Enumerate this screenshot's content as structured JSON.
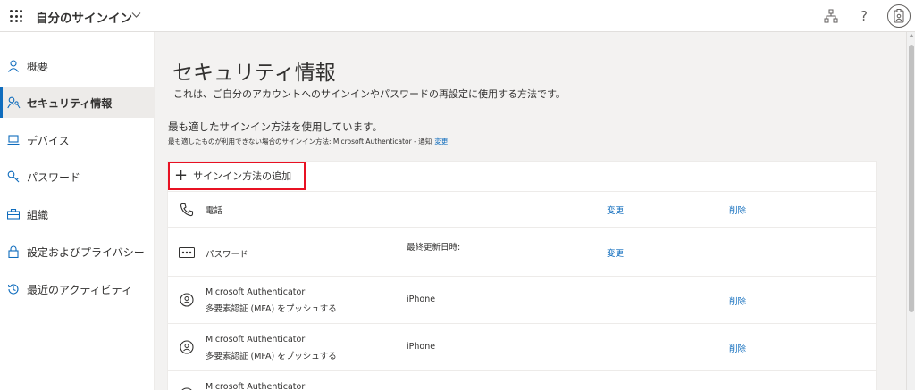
{
  "header": {
    "app_title": "自分のサインイン",
    "help": "?"
  },
  "sidebar": {
    "items": [
      {
        "label": "概要",
        "icon": "person-icon"
      },
      {
        "label": "セキュリティ情報",
        "icon": "security-key-person-icon",
        "active": true
      },
      {
        "label": "デバイス",
        "icon": "laptop-icon"
      },
      {
        "label": "パスワード",
        "icon": "key-icon"
      },
      {
        "label": "組織",
        "icon": "briefcase-icon"
      },
      {
        "label": "設定およびプライバシー",
        "icon": "lock-icon"
      },
      {
        "label": "最近のアクティビティ",
        "icon": "history-icon"
      }
    ]
  },
  "main": {
    "title": "セキュリティ情報",
    "description": "これは、ご自分のアカウントへのサインインやパスワードの再設定に使用する方法です。",
    "default_method_title": "最も適したサインイン方法を使用しています。",
    "default_method_sub": "最も適したものが利用できない場合のサインイン方法: Microsoft Authenticator - 通知",
    "default_method_change": "変更",
    "add_method_label": "サインイン方法の追加",
    "methods": [
      {
        "name": "電話",
        "sub": "",
        "detail": "",
        "change": "変更",
        "delete": "削除",
        "icon": "phone-icon"
      },
      {
        "name": "パスワード",
        "sub": "",
        "detail": "最終更新日時:",
        "change": "変更",
        "delete": "",
        "icon": "password-icon"
      },
      {
        "name": "Microsoft Authenticator",
        "sub": "多要素認証 (MFA) をプッシュする",
        "detail": "iPhone",
        "change": "",
        "delete": "削除",
        "icon": "authenticator-icon"
      },
      {
        "name": "Microsoft Authenticator",
        "sub": "多要素認証 (MFA) をプッシュする",
        "detail": "iPhone",
        "change": "",
        "delete": "削除",
        "icon": "authenticator-icon"
      },
      {
        "name": "Microsoft Authenticator",
        "sub": "",
        "detail": "",
        "change": "",
        "delete": "",
        "icon": "authenticator-icon"
      }
    ]
  },
  "colors": {
    "accent": "#0f6cbd",
    "highlight_border": "#e81123",
    "content_bg": "#f3f2f1"
  }
}
